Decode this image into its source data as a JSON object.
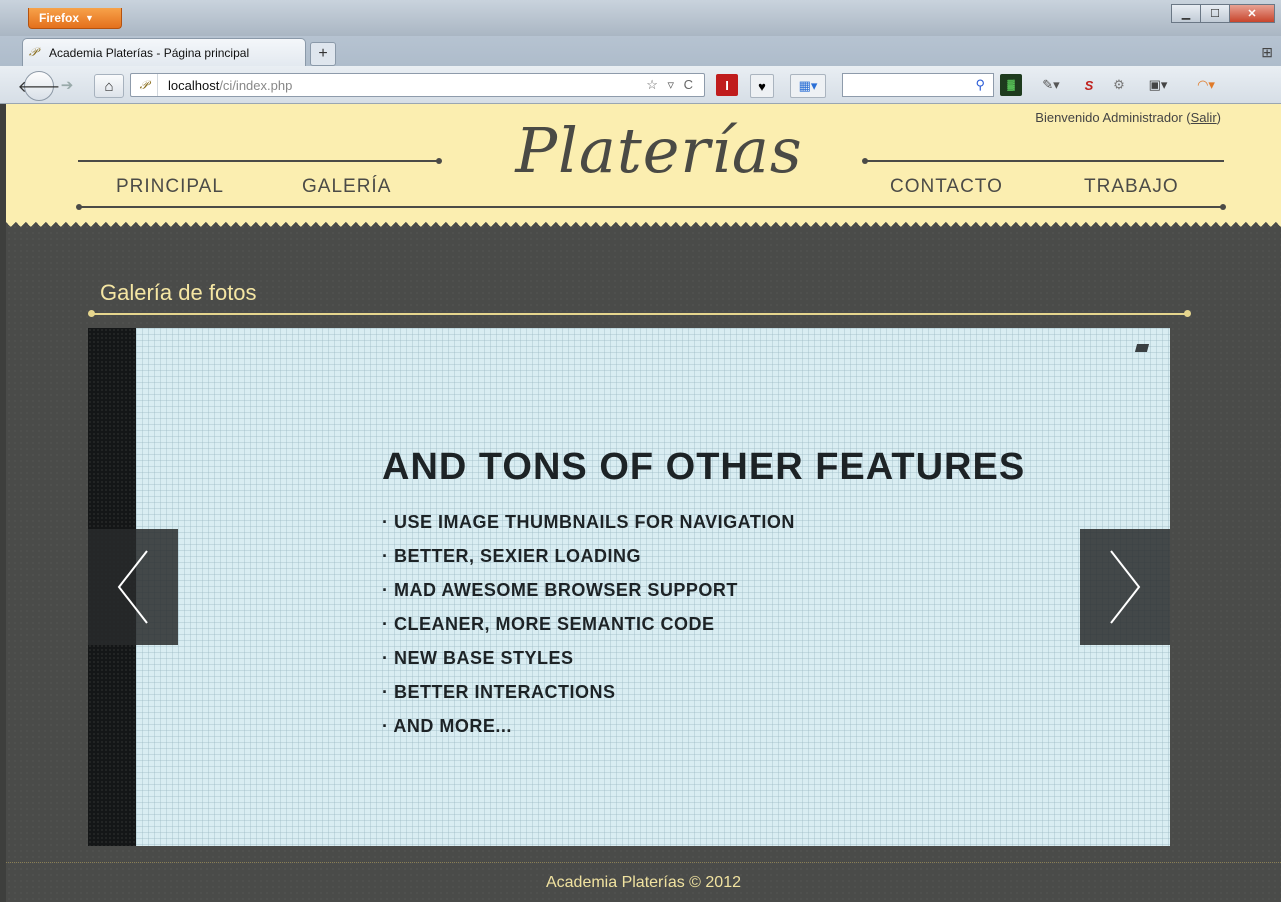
{
  "browser": {
    "menu_label": "Firefox",
    "tab_title": "Academia Platerías - Página principal",
    "url_host": "localhost",
    "url_path": "/ci/index.php",
    "url_actions": "☆ ▿ C"
  },
  "site": {
    "welcome_text": "Bienvenido Administrador (",
    "logout_label": "Salir",
    "welcome_close": ")",
    "logo": "Platerías",
    "nav": {
      "principal": "PRINCIPAL",
      "galeria": "GALERÍA",
      "contacto": "CONTACTO",
      "trabajo": "TRABAJO"
    },
    "section_title": "Galería de fotos",
    "footer": "Academia Platerías © 2012"
  },
  "slide": {
    "heading": "AND TONS OF OTHER FEATURES",
    "items": [
      "USE IMAGE THUMBNAILS FOR NAVIGATION",
      "BETTER, SEXIER LOADING",
      "MAD AWESOME BROWSER SUPPORT",
      "CLEANER, MORE SEMANTIC CODE",
      "NEW BASE STYLES",
      "BETTER INTERACTIONS",
      "AND MORE..."
    ]
  },
  "colors": {
    "header_bg": "#fbeeb0",
    "page_bg": "#4a4b49",
    "accent": "#f5e6a3",
    "slide_bg": "#d9edf2"
  }
}
